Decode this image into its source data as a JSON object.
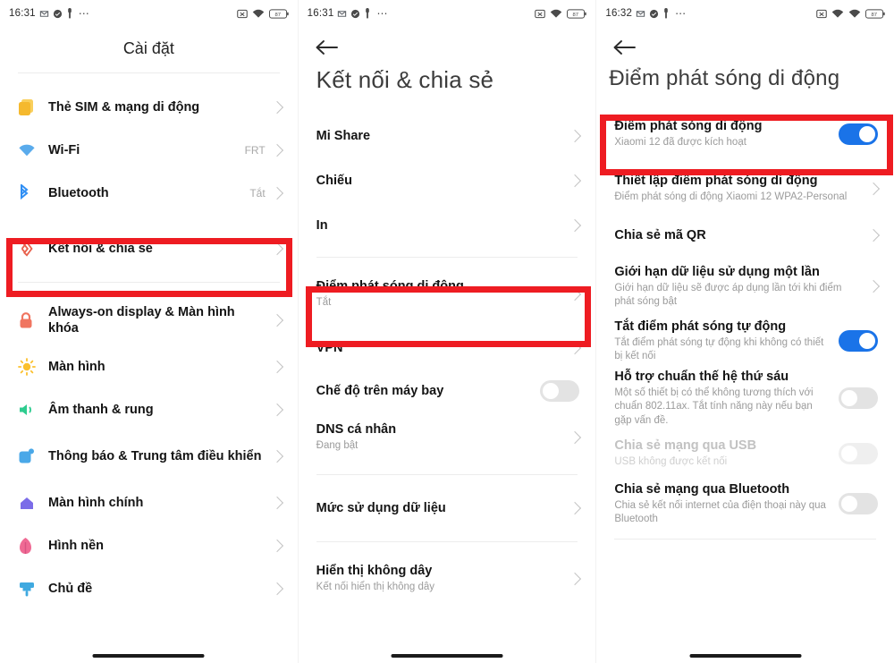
{
  "statusbar": {
    "time_1": "16:31",
    "time_2": "16:31",
    "time_3": "16:32",
    "battery": "87",
    "icons_left": [
      "gmail-icon",
      "check-shield-icon",
      "key-icon",
      "more-dots-icon"
    ],
    "icons_right": [
      "no-sim-icon",
      "wifi-icon",
      "battery-icon"
    ]
  },
  "screen1": {
    "title": "Cài đặt",
    "items": [
      {
        "label": "Thẻ SIM & mạng di động",
        "value": "",
        "icon": "sim-card-icon",
        "color": "#f7c343"
      },
      {
        "label": "Wi-Fi",
        "value": "FRT",
        "icon": "wifi-icon",
        "color": "#4fa8f0"
      },
      {
        "label": "Bluetooth",
        "value": "Tắt",
        "icon": "bluetooth-icon",
        "color": "#2f8ef4"
      },
      {
        "label": "Kết nối & chia sẻ",
        "value": "",
        "icon": "connection-share-icon",
        "color": "#e8604c",
        "highlighted": true
      },
      {
        "label": "Always-on display & Màn hình khóa",
        "value": "",
        "icon": "lock-icon",
        "color": "#f07560"
      },
      {
        "label": "Màn hình",
        "value": "",
        "icon": "brightness-icon",
        "color": "#fbc02d"
      },
      {
        "label": "Âm thanh & rung",
        "value": "",
        "icon": "speaker-icon",
        "color": "#2ecc8f"
      },
      {
        "label": "Thông báo & Trung tâm điều khiển",
        "value": "",
        "icon": "notification-icon",
        "color": "#4aa8e8"
      },
      {
        "label": "Màn hình chính",
        "value": "",
        "icon": "home-icon",
        "color": "#7b6ce8"
      },
      {
        "label": "Hình nền",
        "value": "",
        "icon": "wallpaper-flower-icon",
        "color": "#ef6a94"
      },
      {
        "label": "Chủ đề",
        "value": "",
        "icon": "theme-brush-icon",
        "color": "#3fa9e0"
      }
    ]
  },
  "screen2": {
    "title": "Kết nối & chia sẻ",
    "back_icon": "back-arrow-icon",
    "items": [
      {
        "label": "Mi Share",
        "sub": "",
        "type": "chevron"
      },
      {
        "label": "Chiếu",
        "sub": "",
        "type": "chevron"
      },
      {
        "label": "In",
        "sub": "",
        "type": "chevron"
      },
      {
        "label": "Điểm phát sóng di động",
        "sub": "Tắt",
        "type": "chevron",
        "highlighted": true
      },
      {
        "label": "VPN",
        "sub": "",
        "type": "chevron"
      },
      {
        "label": "Chế độ trên máy bay",
        "sub": "",
        "type": "toggle",
        "toggle_on": false
      },
      {
        "label": "DNS cá nhân",
        "sub": "Đang bật",
        "type": "chevron"
      },
      {
        "label": "Mức sử dụng dữ liệu",
        "sub": "",
        "type": "chevron"
      },
      {
        "label": "Hiển thị không dây",
        "sub": "Kết nối hiển thị không dây",
        "type": "chevron"
      }
    ]
  },
  "screen3": {
    "title": "Điểm phát sóng di động",
    "back_icon": "back-arrow-icon",
    "items": [
      {
        "label": "Điểm phát sóng di động",
        "sub": "Xiaomi 12 đã được kích hoạt",
        "type": "toggle",
        "toggle_on": true,
        "highlighted": true
      },
      {
        "label": "Thiết lập điểm phát sóng di động",
        "sub": "Điểm phát sóng di động Xiaomi 12 WPA2-Personal",
        "type": "chevron"
      },
      {
        "label": "Chia sẻ mã QR",
        "sub": "",
        "type": "chevron"
      },
      {
        "label": "Giới hạn dữ liệu sử dụng một lần",
        "sub": "Giới hạn dữ liệu sẽ được áp dụng lần tới khi điểm phát sóng bật",
        "type": "chevron"
      },
      {
        "label": "Tắt điểm phát sóng tự động",
        "sub": "Tắt điểm phát sóng tự động khi không có thiết bị kết nối",
        "type": "toggle",
        "toggle_on": true
      },
      {
        "label": "Hỗ trợ chuẩn thế hệ thứ sáu",
        "sub": "Một số thiết bị có thể không tương thích với chuẩn 802.11ax. Tắt tính năng này nếu bạn gặp vấn đề.",
        "type": "toggle",
        "toggle_on": false
      },
      {
        "label": "Chia sẻ mạng qua USB",
        "sub": "USB không được kết nối",
        "type": "toggle",
        "toggle_on": false,
        "disabled": true
      },
      {
        "label": "Chia sẻ mạng qua Bluetooth",
        "sub": "Chia sẻ kết nối internet của điện thoại này qua Bluetooth",
        "type": "toggle",
        "toggle_on": false
      }
    ]
  },
  "colors": {
    "highlight": "#ee1c22",
    "toggle_on": "#1a73e8",
    "toggle_off": "#e3e3e3"
  }
}
